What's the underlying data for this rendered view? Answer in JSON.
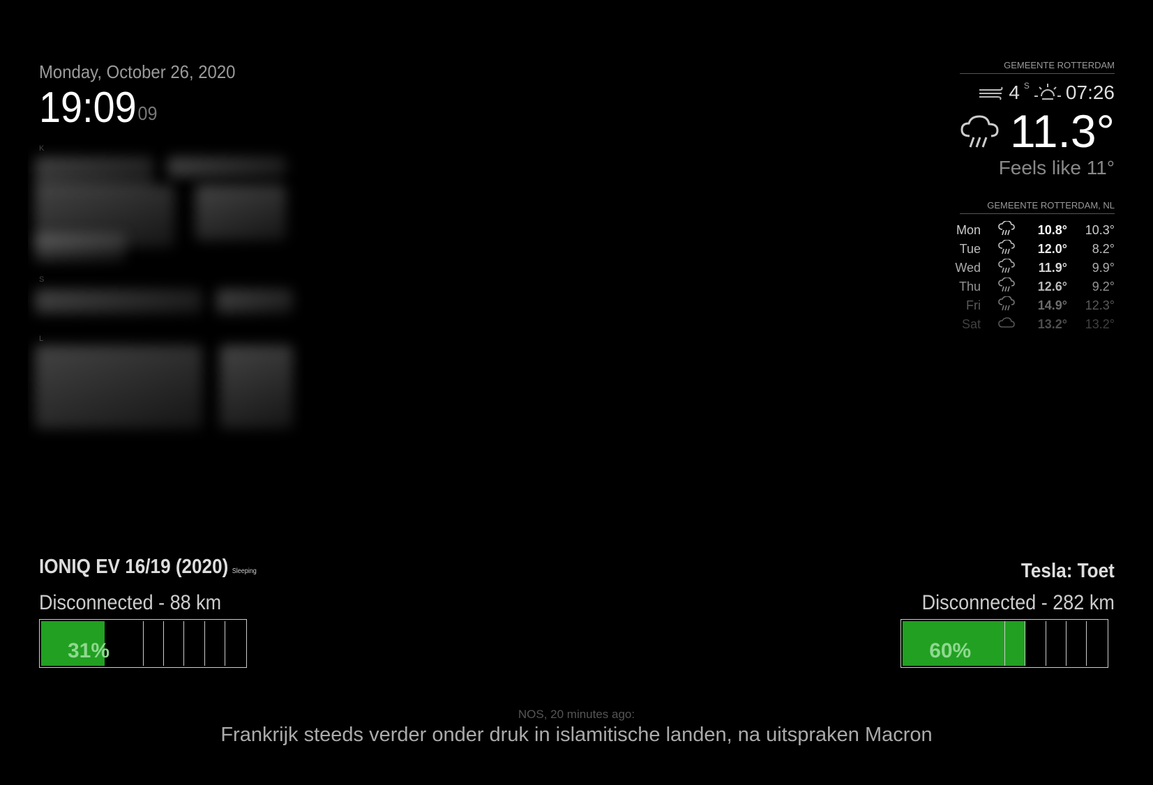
{
  "clock": {
    "date": "Monday, October 26, 2020",
    "time": "19:09",
    "seconds": "09"
  },
  "calendar": {
    "blurred": true,
    "section_initials": [
      "K",
      "S",
      "L"
    ]
  },
  "weather": {
    "current": {
      "location": "GEMEENTE ROTTERDAM",
      "wind_speed": "4",
      "wind_dir": "S",
      "sun_time": "07:26",
      "temperature": "11.3°",
      "feels_like": "Feels like 11°",
      "icon": "rain-cloud-icon"
    },
    "forecast": {
      "location": "GEMEENTE ROTTERDAM, NL",
      "days": [
        {
          "day": "Mon",
          "max": "10.8°",
          "min": "10.3°",
          "icon": "rain-icon"
        },
        {
          "day": "Tue",
          "max": "12.0°",
          "min": "8.2°",
          "icon": "rain-icon"
        },
        {
          "day": "Wed",
          "max": "11.9°",
          "min": "9.9°",
          "icon": "rain-icon"
        },
        {
          "day": "Thu",
          "max": "12.6°",
          "min": "9.2°",
          "icon": "rain-icon"
        },
        {
          "day": "Fri",
          "max": "14.9°",
          "min": "12.3°",
          "icon": "rain-icon"
        },
        {
          "day": "Sat",
          "max": "13.2°",
          "min": "13.2°",
          "icon": "cloud-icon"
        }
      ]
    }
  },
  "cars": {
    "ioniq": {
      "title": "IONIQ EV 16/19 (2020)",
      "state": "Sleeping",
      "status": "Disconnected - 88 km",
      "battery_pct": 31,
      "battery_label": "31%"
    },
    "tesla": {
      "title": "Tesla: Toet",
      "status": "Disconnected - 282 km",
      "battery_pct": 60,
      "battery_label": "60%"
    }
  },
  "news": {
    "source": "NOS, 20 minutes ago:",
    "headline": "Frankrijk steeds verder onder druk in islamitische landen, na uitspraken Macron"
  },
  "colors": {
    "background": "#000000",
    "battery_fill": "#22a022"
  }
}
